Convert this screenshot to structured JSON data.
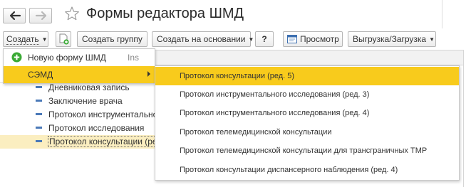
{
  "header": {
    "title": "Формы редактора ШМД"
  },
  "toolbar": {
    "create_label": "Создать",
    "create_group_label": "Создать группу",
    "create_basis_label": "Создать на основании",
    "help_label": "?",
    "view_label": "Просмотр",
    "export_label": "Выгрузка/Загрузка"
  },
  "create_menu": {
    "items": [
      {
        "label": "Новую форму ШМД",
        "shortcut": "Ins",
        "icon": "plus-circle-icon"
      },
      {
        "label": "СЭМД",
        "icon": "submenu-arrow-icon",
        "active": true
      }
    ]
  },
  "semd_submenu": {
    "items": [
      {
        "label": "Протокол консультации (ред. 5)",
        "active": true
      },
      {
        "label": "Протокол инструментального исследования (ред. 3)"
      },
      {
        "label": "Протокол инструментального исследования (ред. 4)"
      },
      {
        "label": "Протокол телемедицинской консультации"
      },
      {
        "label": "Протокол телемедицинской консультации для трансграничных ТМР"
      },
      {
        "label": "Протокол консультации диспансерного наблюдения  (ред. 4)"
      }
    ]
  },
  "list": {
    "rows": [
      {
        "label": "Дневниковая запись"
      },
      {
        "label": "Заключение врача"
      },
      {
        "label": "Протокол инструментального"
      },
      {
        "label": "Протокол исследования"
      },
      {
        "label": "Протокол консультации (ред.",
        "selected": true
      }
    ]
  },
  "colors": {
    "highlight": "#f8cb1c",
    "selected_row": "#fbeec0",
    "row_icon": "#4a79b8",
    "plus_icon": "#3aaa35"
  }
}
